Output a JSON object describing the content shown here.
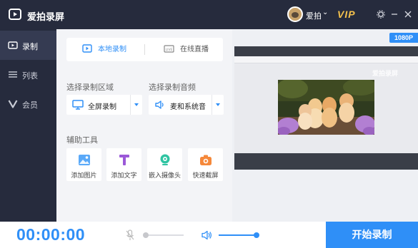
{
  "app": {
    "title": "爱拍录屏"
  },
  "user": {
    "name": "爱拍",
    "caret": "⌄",
    "vip_label": "VIP"
  },
  "window_controls": {
    "settings_icon": "gear-icon",
    "minimize_icon": "minimize-icon",
    "close_icon": "close-icon"
  },
  "sidebar": {
    "items": [
      {
        "label": "录制",
        "icon": "video-camera-icon",
        "active": true
      },
      {
        "label": "列表",
        "icon": "list-icon",
        "active": false
      },
      {
        "label": "会员",
        "icon": "vip-v-icon",
        "active": false
      }
    ]
  },
  "mode_tabs": [
    {
      "label": "本地录制",
      "icon": "play-screen-icon",
      "active": true
    },
    {
      "label": "在线直播",
      "icon": "live-icon",
      "active": false
    }
  ],
  "record_area": {
    "label": "选择录制区域",
    "value": "全屏录制",
    "icon": "monitor-icon"
  },
  "record_audio": {
    "label": "选择录制音频",
    "value": "麦和系统音",
    "icon": "speaker-icon"
  },
  "tools": {
    "label": "辅助工具",
    "items": [
      {
        "label": "添加图片",
        "icon": "image-icon"
      },
      {
        "label": "添加文字",
        "icon": "text-t-icon"
      },
      {
        "label": "嵌入摄像头",
        "icon": "webcam-icon"
      },
      {
        "label": "快速截屏",
        "icon": "camera-icon"
      }
    ]
  },
  "preview": {
    "resolution": "1080P",
    "watermark": "爱拍录屏"
  },
  "bottom": {
    "timer": "00:00:00",
    "mic_volume": 0.0,
    "speaker_volume": 1.0,
    "start_label": "开始录制"
  },
  "colors": {
    "accent": "#2f8ff7",
    "dark": "#262b3d",
    "vip": "#f5c24d"
  }
}
